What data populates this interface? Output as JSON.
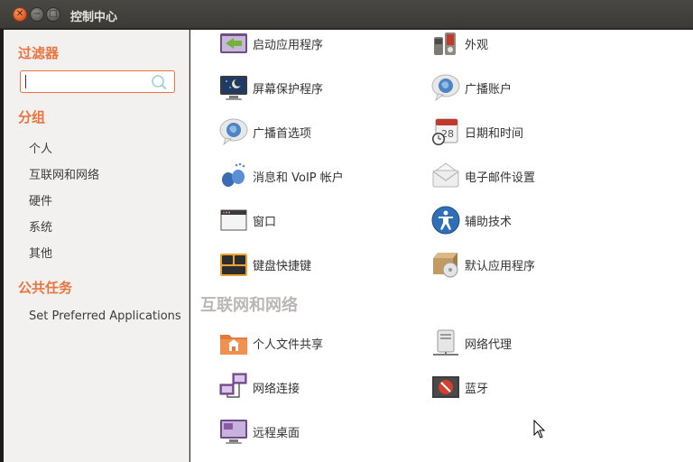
{
  "window": {
    "title": "控制中心"
  },
  "sidebar": {
    "filter_heading": "过滤器",
    "search": {
      "value": ""
    },
    "groups_heading": "分组",
    "groups": [
      "个人",
      "互联网和网络",
      "硬件",
      "系统",
      "其他"
    ],
    "tasks_heading": "公共任务",
    "tasks": [
      "Set Preferred Applications"
    ]
  },
  "main": {
    "personal_items": [
      {
        "label": "启动应用程序",
        "icon": "startup-apps-icon"
      },
      {
        "label": "外观",
        "icon": "appearance-icon"
      },
      {
        "label": "屏幕保护程序",
        "icon": "screensaver-icon"
      },
      {
        "label": "广播账户",
        "icon": "broadcast-accounts-icon"
      },
      {
        "label": "广播首选项",
        "icon": "broadcast-prefs-icon"
      },
      {
        "label": "日期和时间",
        "icon": "calendar-clock-icon"
      },
      {
        "label": "消息和 VoIP 帐户",
        "icon": "messaging-icon"
      },
      {
        "label": "电子邮件设置",
        "icon": "email-icon"
      },
      {
        "label": "窗口",
        "icon": "windows-icon"
      },
      {
        "label": "辅助技术",
        "icon": "accessibility-icon"
      },
      {
        "label": "键盘快捷键",
        "icon": "keyboard-icon"
      },
      {
        "label": "默认应用程序",
        "icon": "default-apps-icon"
      }
    ],
    "internet_heading": "互联网和网络",
    "internet_items": [
      {
        "label": "个人文件共享",
        "icon": "folder-share-icon"
      },
      {
        "label": "网络代理",
        "icon": "network-proxy-icon"
      },
      {
        "label": "网络连接",
        "icon": "network-connections-icon"
      },
      {
        "label": "蓝牙",
        "icon": "bluetooth-icon"
      },
      {
        "label": "远程桌面",
        "icon": "remote-desktop-icon"
      }
    ]
  }
}
